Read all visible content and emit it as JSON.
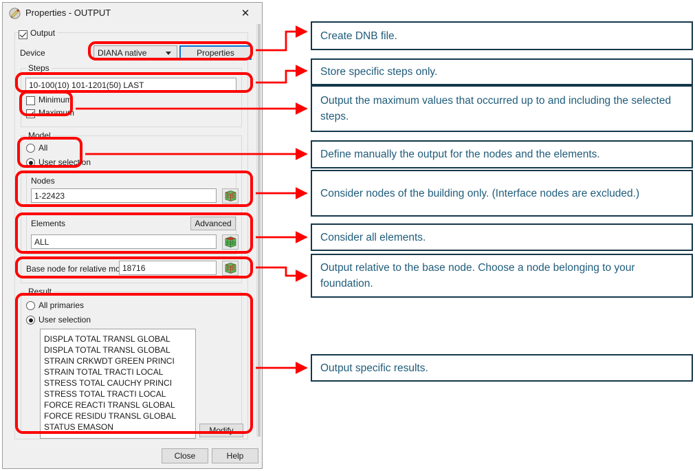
{
  "window": {
    "title": "Properties - OUTPUT",
    "icon": "pencil-edit-icon",
    "close_label": "✕"
  },
  "dialog": {
    "output_group": {
      "label": "Output",
      "checked": true
    },
    "device": {
      "label": "Device",
      "selected": "DIANA native",
      "options": [
        "DIANA native"
      ],
      "properties_button": "Properties"
    },
    "steps": {
      "group_label": "Steps",
      "value": "10-100(10) 101-1201(50) LAST",
      "minimum": {
        "label": "Minimum",
        "checked": false
      },
      "maximum": {
        "label": "Maximum",
        "checked": true
      }
    },
    "model": {
      "group_label": "Model",
      "all": {
        "label": "All",
        "selected": false
      },
      "user_selection": {
        "label": "User selection",
        "selected": true
      },
      "nodes": {
        "label": "Nodes",
        "value": "1-22423",
        "picker_icon": "mesh-cube-icon"
      },
      "elements": {
        "label": "Elements",
        "value": "ALL",
        "advanced_button": "Advanced",
        "picker_icon": "mesh-cube-icon"
      },
      "base_node": {
        "label": "Base node for relative motion",
        "value": "18716",
        "picker_icon": "mesh-cube-icon"
      }
    },
    "result": {
      "group_label": "Result",
      "all_primaries": {
        "label": "All primaries",
        "selected": false
      },
      "user_selection": {
        "label": "User selection",
        "selected": true
      },
      "items": [
        "DISPLA TOTAL TRANSL GLOBAL",
        "DISPLA TOTAL TRANSL GLOBAL",
        "STRAIN CRKWDT GREEN PRINCI",
        "STRAIN TOTAL TRACTI LOCAL",
        "STRESS TOTAL CAUCHY PRINCI",
        "STRESS TOTAL TRACTI LOCAL",
        "FORCE REACTI TRANSL GLOBAL",
        "FORCE RESIDU TRANSL GLOBAL",
        "STATUS EMASON"
      ],
      "modify_button": "Modify"
    },
    "footer": {
      "close_button": "Close",
      "help_button": "Help"
    }
  },
  "annotations": [
    {
      "text": "Create DNB file."
    },
    {
      "text": "Store specific steps only."
    },
    {
      "text": "Output the maximum values that occurred up to and including the selected steps."
    },
    {
      "text": "Define manually the output for the nodes and the elements."
    },
    {
      "text": "Consider nodes of the building only. (Interface nodes are excluded.)"
    },
    {
      "text": "Consider all elements."
    },
    {
      "text": "Output relative to the base node. Choose a node belonging to your foundation."
    },
    {
      "text": "Output specific results."
    }
  ],
  "colors": {
    "highlight": "#ff0000",
    "annotation_border": "#14374a",
    "annotation_text": "#1f5c7a",
    "focus_border": "#0a74d4",
    "dialog_bg": "#f0f0f0"
  }
}
